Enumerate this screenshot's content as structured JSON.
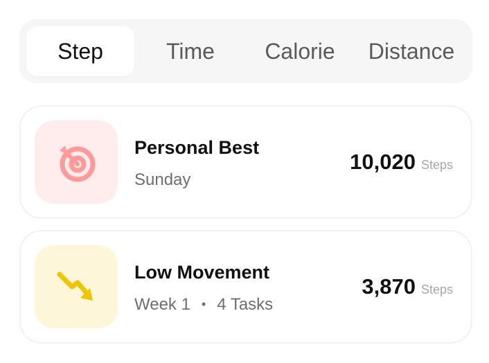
{
  "tabs": [
    {
      "label": "Step",
      "active": true
    },
    {
      "label": "Time",
      "active": false
    },
    {
      "label": "Calorie",
      "active": false
    },
    {
      "label": "Distance",
      "active": false
    }
  ],
  "cards": [
    {
      "icon": "target-icon",
      "icon_color": "#ff9a9a",
      "tile_color": "#ffecec",
      "title": "Personal Best",
      "subtitle": "Sunday",
      "value": "10,020",
      "unit": "Steps"
    },
    {
      "icon": "trend-down-icon",
      "icon_color": "#f0c400",
      "tile_color": "#fdf6d9",
      "title": "Low Movement",
      "subtitle_week": "Week 1",
      "subtitle_tasks": "4 Tasks",
      "value": "3,870",
      "unit": "Steps"
    }
  ]
}
